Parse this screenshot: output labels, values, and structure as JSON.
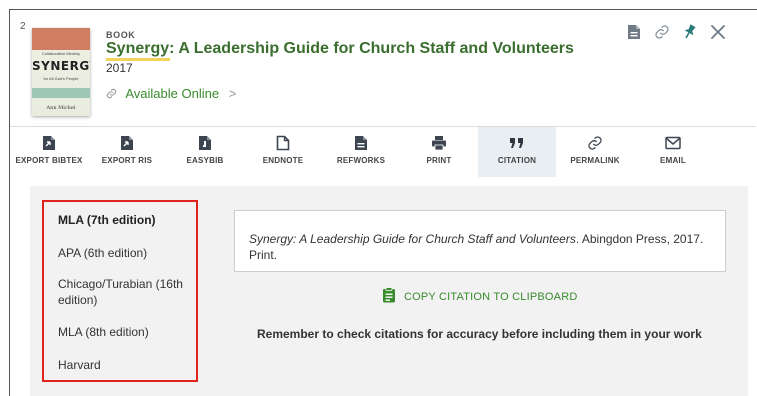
{
  "record": {
    "number": "2",
    "type": "BOOK",
    "title": "Synergy: A Leadership Guide for Church Staff and Volunteers",
    "year": "2017",
    "availability": "Available Online",
    "availability_chevron": ">",
    "cover": {
      "subtitle": "Collaborative Ministry",
      "title": "SYNERGY",
      "tagline": "for All God's People",
      "author": "Ann Michel"
    }
  },
  "top_actions": [
    {
      "icon": "document-icon"
    },
    {
      "icon": "link-icon"
    },
    {
      "icon": "pin-icon"
    },
    {
      "icon": "close-icon"
    }
  ],
  "toolbar": [
    {
      "name": "export-bibtex",
      "label": "EXPORT BIBTEX",
      "icon": "export-file-icon"
    },
    {
      "name": "export-ris",
      "label": "EXPORT RIS",
      "icon": "export-file-icon"
    },
    {
      "name": "easybib",
      "label": "EASYBIB",
      "icon": "easybib-icon"
    },
    {
      "name": "endnote",
      "label": "ENDNOTE",
      "icon": "endnote-icon"
    },
    {
      "name": "refworks",
      "label": "REFWORKS",
      "icon": "refworks-icon"
    },
    {
      "name": "print",
      "label": "PRINT",
      "icon": "printer-icon"
    },
    {
      "name": "citation",
      "label": "CITATION",
      "icon": "quote-icon",
      "active": true
    },
    {
      "name": "permalink",
      "label": "PERMALINK",
      "icon": "link-icon"
    },
    {
      "name": "email",
      "label": "EMAIL",
      "icon": "envelope-icon"
    }
  ],
  "citation_styles": [
    {
      "label": "MLA (7th edition)",
      "selected": true
    },
    {
      "label": "APA (6th edition)",
      "selected": false
    },
    {
      "label": "Chicago/Turabian (16th edition)",
      "selected": false
    },
    {
      "label": "MLA (8th edition)",
      "selected": false
    },
    {
      "label": "Harvard",
      "selected": false
    }
  ],
  "citation": {
    "title_part": "Synergy: A Leadership Guide for Church Staff and Volunteers",
    "rest": ". Abingdon Press, 2017. Print."
  },
  "copy_button_label": "COPY CITATION TO CLIPBOARD",
  "reminder": "Remember to check citations for accuracy before including them in your work",
  "colors": {
    "title_green": "#3a6e2e",
    "accent_green": "#3a8a2e",
    "highlight_yellow": "#f4d35a",
    "selection_red": "#e0231d",
    "panel_gray": "#f2f2f2",
    "active_tab": "#e9eef3"
  }
}
